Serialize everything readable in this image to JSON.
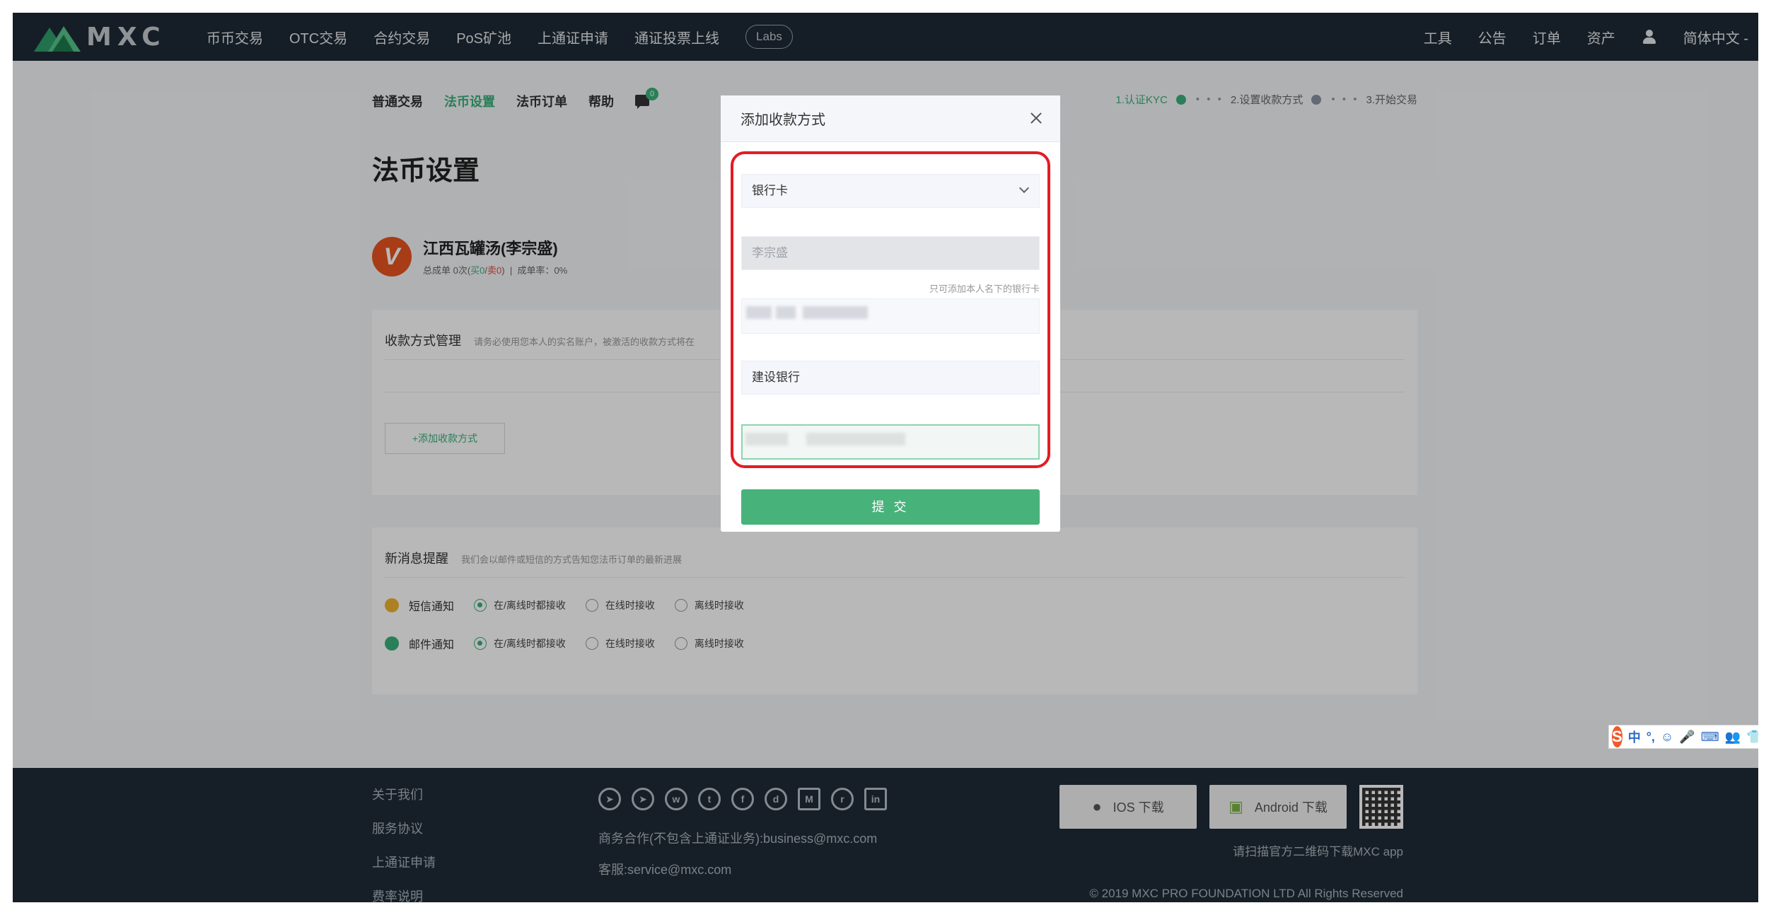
{
  "nav": {
    "logo_text": "MXC",
    "items": [
      "币币交易",
      "OTC交易",
      "合约交易",
      "PoS矿池",
      "上通证申请",
      "通证投票上线"
    ],
    "labs": "Labs",
    "right_items": [
      "工具",
      "公告",
      "订单",
      "资产"
    ],
    "language": "简体中文"
  },
  "subnav": {
    "items": [
      "普通交易",
      "法币设置",
      "法币订单",
      "帮助"
    ],
    "active": "法币设置",
    "chat_badge": "0"
  },
  "steps": {
    "step1": "1.认证KYC",
    "step2": "2.设置收款方式",
    "step3": "3.开始交易",
    "ellipsis": "• • •"
  },
  "page": {
    "title": "法币设置"
  },
  "profile": {
    "avatar_letter": "V",
    "name": "江西瓦罐汤(李宗盛)",
    "stats_prefix": "总成单 0次(",
    "buy": "买0",
    "sep": "/",
    "sell": "卖0",
    "stats_mid": ")",
    "rate": "成单率：0%"
  },
  "payment_card": {
    "title": "收款方式管理",
    "desc": "请务必使用您本人的实名账户，被激活的收款方式将在",
    "add_button": "+添加收款方式"
  },
  "notify_card": {
    "title": "新消息提醒",
    "desc": "我们会以邮件或短信的方式告知您法币订单的最新进展",
    "rows": [
      {
        "label": "短信通知",
        "options": [
          "在/离线时都接收",
          "在线时接收",
          "离线时接收"
        ],
        "selected": 0
      },
      {
        "label": "邮件通知",
        "options": [
          "在/离线时都接收",
          "在线时接收",
          "离线时接收"
        ],
        "selected": 0
      }
    ]
  },
  "modal": {
    "title": "添加收款方式",
    "method_select": "银行卡",
    "name_placeholder": "李宗盛",
    "hint": "只可添加本人名下的银行卡",
    "bank_name": "建设银行",
    "submit": "提 交"
  },
  "footer": {
    "links": [
      "关于我们",
      "服务协议",
      "上通证申请",
      "费率说明"
    ],
    "business": "商务合作(不包含上通证业务):business@mxc.com",
    "service": "客服:service@mxc.com",
    "ios": "IOS 下载",
    "android": "Android 下载",
    "qr_note": "请扫描官方二维码下载MXC app",
    "copyright": "© 2019 MXC PRO FOUNDATION LTD All Rights Reserved"
  },
  "social_icons": [
    "telegram-icon",
    "telegram-alt-icon",
    "weibo-icon",
    "twitter-icon",
    "facebook-icon",
    "discord-icon",
    "medium-icon",
    "reddit-icon",
    "linkedin-icon"
  ],
  "ime": {
    "items": [
      "中",
      "°,",
      "☺",
      "🎤",
      "⌨",
      "👥",
      "👕",
      "⊞"
    ]
  },
  "colors": {
    "accent": "#3ab07a",
    "nav_bg": "#1e2a35",
    "highlight": "#e31c23",
    "submit": "#48b27b"
  }
}
